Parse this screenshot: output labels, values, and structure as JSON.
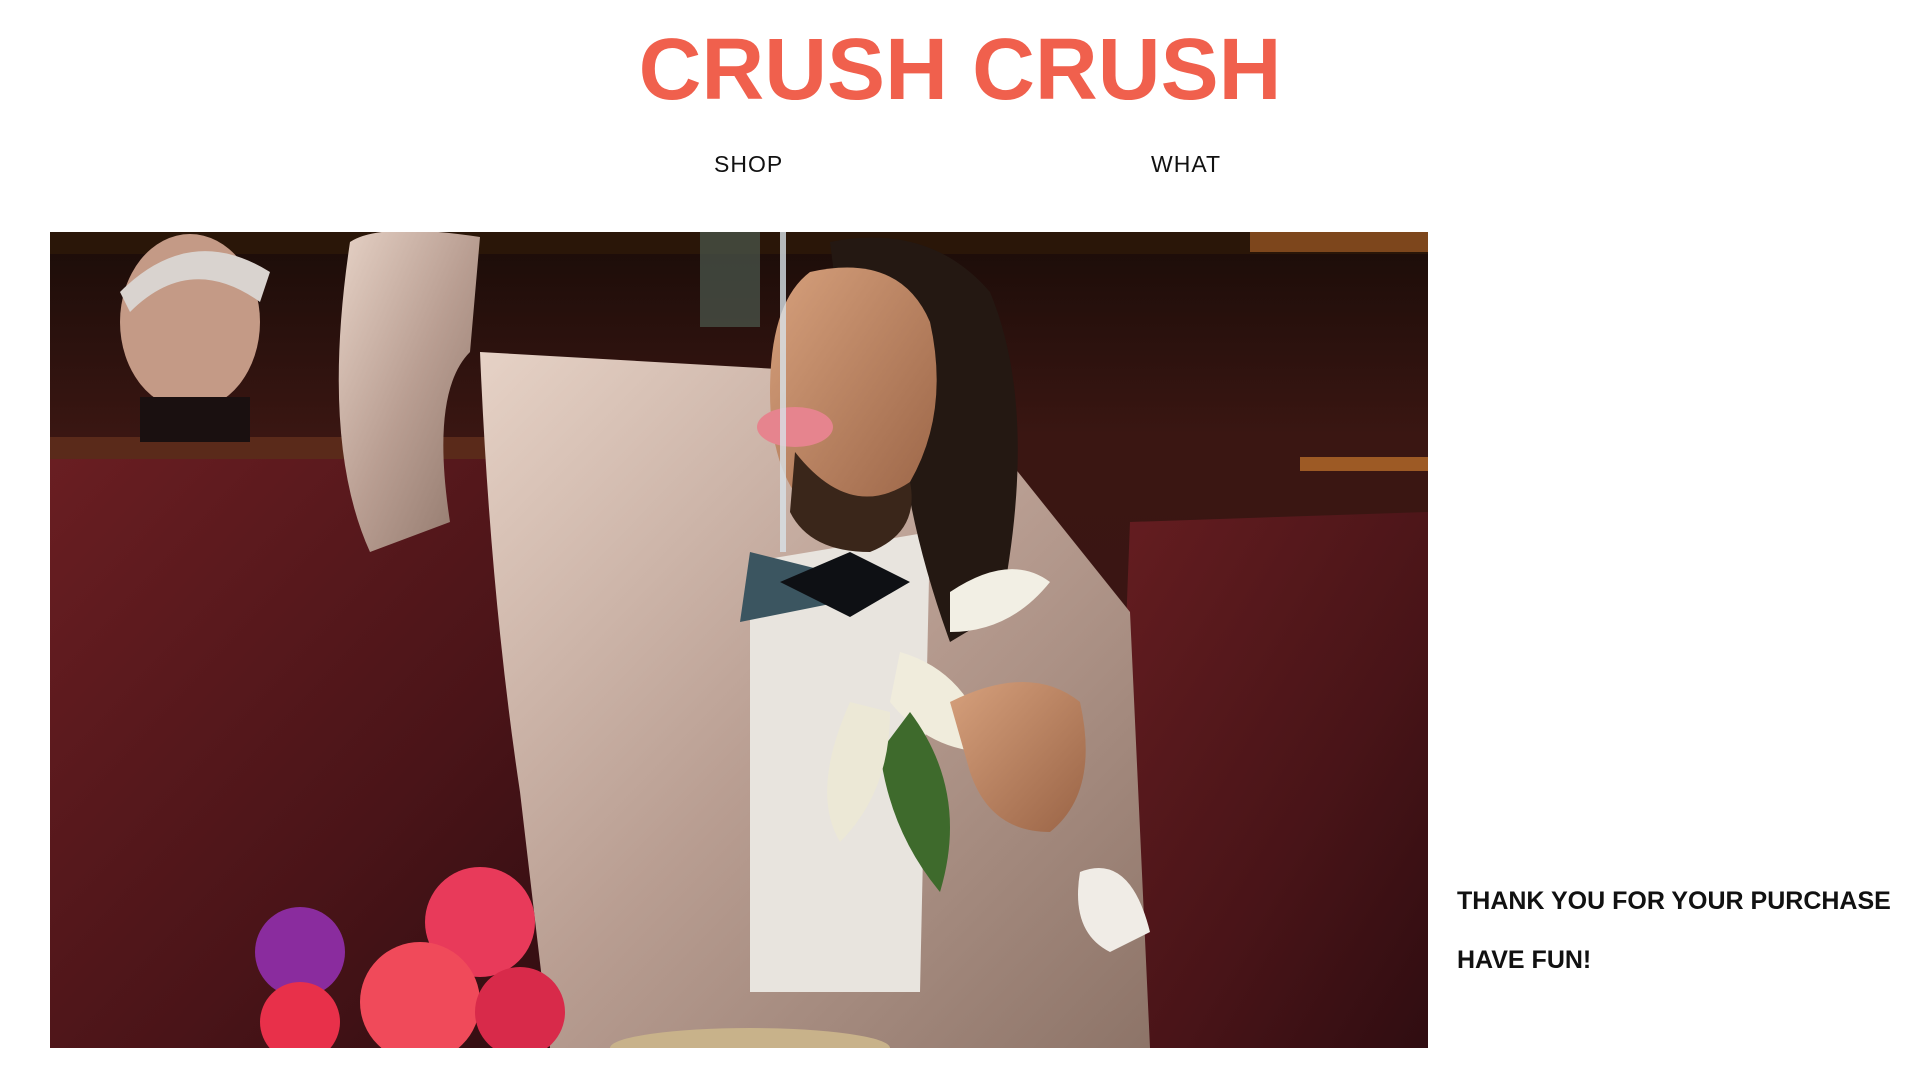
{
  "header": {
    "brand": "CRUSH CRUSH",
    "brand_color": "#f0604d"
  },
  "nav": {
    "items": [
      {
        "label": "SHOP"
      },
      {
        "label": "WHAT"
      }
    ]
  },
  "hero": {
    "icon": "photo"
  },
  "message": {
    "line1": "THANK YOU FOR YOUR PURCHASE",
    "line2": "HAVE FUN!"
  }
}
